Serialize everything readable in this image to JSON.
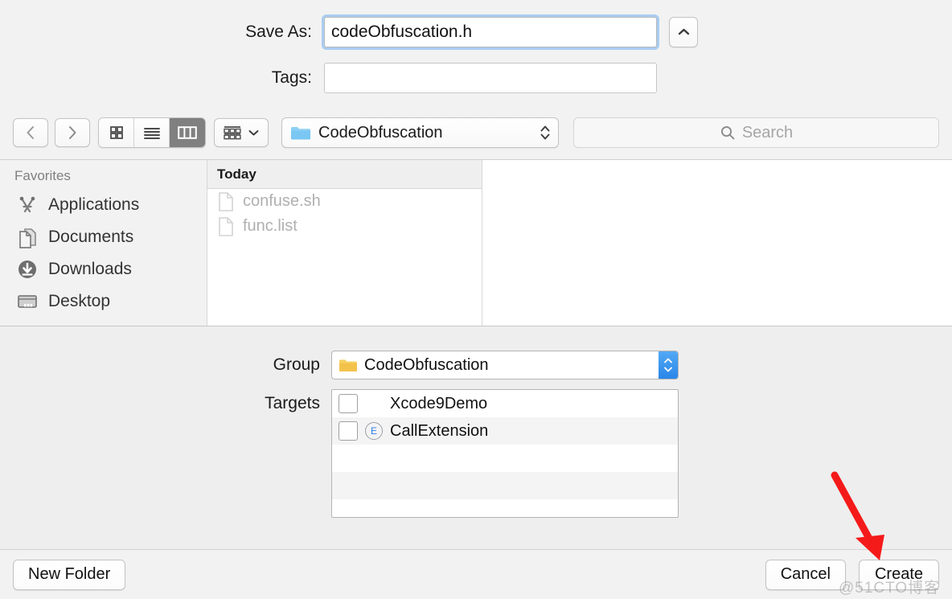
{
  "save_as": {
    "label": "Save As:",
    "value": "codeObfuscation.h",
    "disclosure_icon": "chevron-up-icon"
  },
  "tags": {
    "label": "Tags:",
    "value": "",
    "placeholder": ""
  },
  "toolbar": {
    "back_icon": "chevron-left-icon",
    "forward_icon": "chevron-right-icon",
    "view_modes": [
      {
        "name": "icon-view",
        "icon": "grid-icon",
        "active": false
      },
      {
        "name": "list-view",
        "icon": "list-icon",
        "active": false
      },
      {
        "name": "column-view",
        "icon": "columns-icon",
        "active": true
      }
    ],
    "arrange": {
      "icon": "arrange-icon",
      "chevron": "chevron-down-icon"
    },
    "path": {
      "icon": "folder-blue-icon",
      "label": "CodeObfuscation",
      "stepper": "updown-chevrons-icon"
    },
    "search": {
      "icon": "search-icon",
      "placeholder": "Search",
      "value": ""
    }
  },
  "sidebar": {
    "header": "Favorites",
    "items": [
      {
        "label": "Applications",
        "icon": "applications-icon"
      },
      {
        "label": "Documents",
        "icon": "documents-icon"
      },
      {
        "label": "Downloads",
        "icon": "downloads-icon"
      },
      {
        "label": "Desktop",
        "icon": "desktop-icon"
      }
    ]
  },
  "file_browser": {
    "group_header": "Today",
    "files": [
      {
        "name": "confuse.sh",
        "icon": "file-icon",
        "disabled": true
      },
      {
        "name": "func.list",
        "icon": "file-icon",
        "disabled": true
      }
    ]
  },
  "accessory": {
    "group": {
      "label": "Group",
      "icon": "folder-yellow-icon",
      "value": "CodeObfuscation"
    },
    "targets": {
      "label": "Targets",
      "rows": [
        {
          "name": "Xcode9Demo",
          "checked": false,
          "badge": ""
        },
        {
          "name": "CallExtension",
          "checked": false,
          "badge": "E"
        },
        {
          "name": "",
          "checked": null,
          "badge": ""
        },
        {
          "name": "",
          "checked": null,
          "badge": ""
        },
        {
          "name": "",
          "checked": null,
          "badge": ""
        }
      ]
    }
  },
  "footer": {
    "new_folder": "New Folder",
    "cancel": "Cancel",
    "create": "Create"
  },
  "annotations": {
    "arrow_color": "#f51a1a",
    "watermark": "@51CTO博客"
  }
}
